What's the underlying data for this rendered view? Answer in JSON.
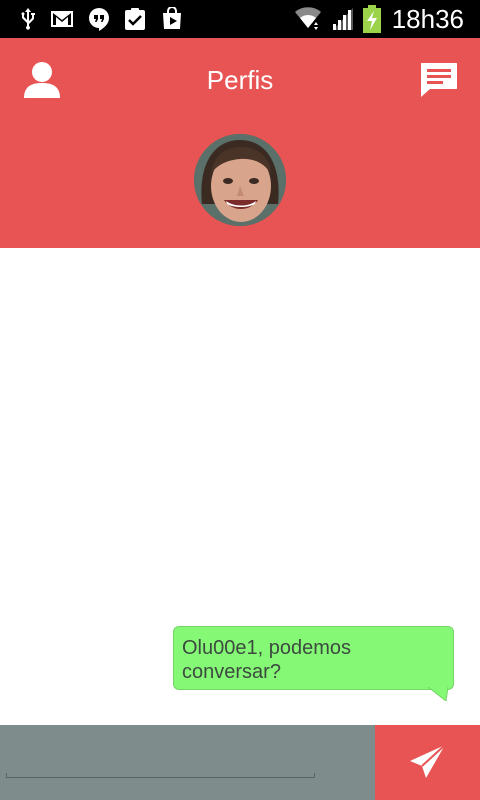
{
  "status_bar": {
    "time": "18h36",
    "icons": [
      "usb-icon",
      "gmail-icon",
      "hangouts-icon",
      "clipboard-check-icon",
      "play-store-icon",
      "wifi-icon",
      "signal-icon",
      "battery-charging-icon"
    ]
  },
  "header": {
    "title": "Perfis",
    "left_icon": "person-icon",
    "right_icon": "message-icon",
    "color": "#e85454"
  },
  "messages": [
    {
      "text": "Olu00e1, podemos conversar?",
      "sender": "me",
      "color": "#85f975"
    }
  ],
  "input": {
    "value": "",
    "placeholder": ""
  },
  "send_button": {
    "icon": "send-icon"
  }
}
